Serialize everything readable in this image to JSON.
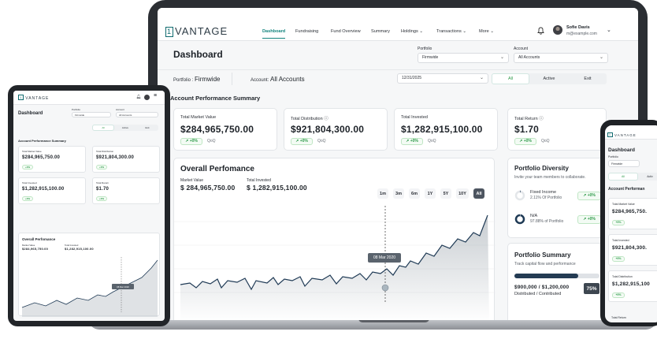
{
  "brand": {
    "box": "1",
    "name": "VANTAGE"
  },
  "nav": {
    "items": [
      "Dashboard",
      "Fundraising",
      "Fund Overview",
      "Summary",
      "Holdings",
      "Transactions",
      "More"
    ],
    "user_name": "Sofie Davis",
    "user_email": "m@example.com"
  },
  "page": {
    "title": "Dashboard"
  },
  "filters": {
    "portfolio_label": "Portfolio",
    "portfolio_value": "Firmwide",
    "account_label": "Account",
    "account_value": "All Accounts",
    "portfolio_prefix": "Portfolio :",
    "portfolio_name": "Firmwide",
    "account_prefix": "Account:",
    "account_name": "All Accounts",
    "date": "12/31/2025"
  },
  "segments": [
    "All",
    "Active",
    "Exit"
  ],
  "summary": {
    "title": "Account Performance Summary",
    "cards": [
      {
        "label": "Total Market Value",
        "value": "$284,965,750.00",
        "delta": "+0%",
        "period": "QoQ"
      },
      {
        "label": "Total Distribution",
        "value": "$921,804,300.00",
        "delta": "+0%",
        "period": "QoQ"
      },
      {
        "label": "Total Invested",
        "value": "$1,282,915,100.00",
        "delta": "+0%",
        "period": "QoQ"
      },
      {
        "label": "Total Return",
        "value": "$1.70",
        "delta": "+0%",
        "period": "QoQ"
      }
    ]
  },
  "performance": {
    "title": "Overall Perfomance",
    "mv_label": "Market Value",
    "mv_value": "$ 284,965,750.00",
    "inv_label": "Total Invested",
    "inv_value": "$ 1,282,915,100.00",
    "ranges": [
      "1m",
      "3m",
      "6m",
      "1Y",
      "5Y",
      "10Y",
      "All"
    ],
    "active_range": "All",
    "tooltip": "08 Mar 2020",
    "tooltip_short": "08 Mar 2020"
  },
  "diversity": {
    "title": "Portfolio Diversity",
    "subtitle": "Invite your team members to collaborate.",
    "items": [
      {
        "name": "Fixed Income",
        "detail": "2.11% Of Portfolio",
        "delta": "+0%"
      },
      {
        "name": "N/A",
        "detail": "97.88% of Portfolio",
        "delta": "+0%"
      }
    ]
  },
  "psummary": {
    "title": "Portfolio Summary",
    "subtitle": "Track capital flow and performance",
    "amount": "$900,000 / $1,200,000",
    "desc": "Distributed  /  Contributed",
    "percent": "75%",
    "progress": 0.75
  },
  "tablet": {
    "title": "Dashboard",
    "mv_value": "$284,965,750.00",
    "inv_value": "$1,282,915,100.00"
  },
  "phone": {
    "title": "Dashboard",
    "mv_trunc": "$284,965,750.",
    "dist_trunc": "$921,804,300.",
    "inv_trunc": "$1,282,915,100",
    "perf_trunc": "Account Performan",
    "active_trunc": "Activ",
    "return_label_trunc": "Total Return"
  }
}
